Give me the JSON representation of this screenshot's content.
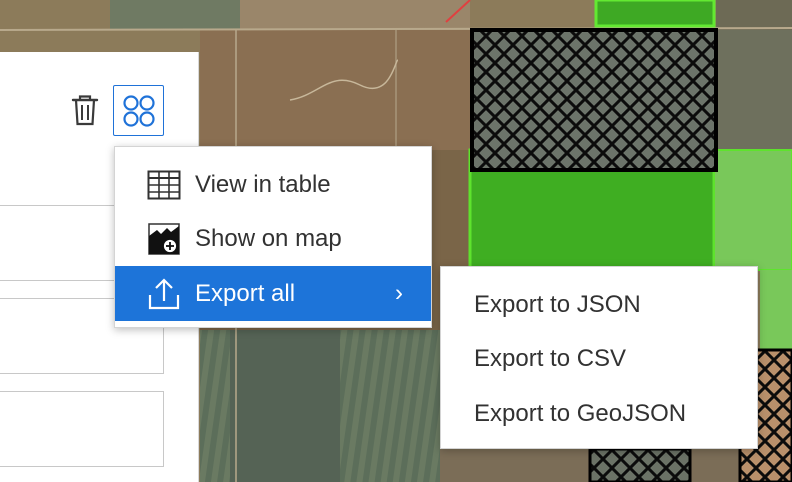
{
  "map": {
    "colors": {
      "field_brown": "#8a7a5c",
      "field_green": "#3fae22",
      "field_light_green": "#79c85a",
      "hatch": "#111111",
      "selection_outline": "#5ee32d"
    }
  },
  "panel": {
    "delete_icon": "trash-icon",
    "more_icon": "grid-dots-icon"
  },
  "menu": {
    "items": [
      {
        "label": "View in table",
        "icon": "table-icon"
      },
      {
        "label": "Show on map",
        "icon": "map-zoom-icon"
      },
      {
        "label": "Export all",
        "icon": "upload-icon",
        "chevron": "›",
        "active": true
      }
    ]
  },
  "submenu": {
    "items": [
      {
        "label": "Export to JSON"
      },
      {
        "label": "Export to CSV"
      },
      {
        "label": "Export to GeoJSON"
      }
    ]
  },
  "theme": {
    "accent": "#1d74d9",
    "text": "#323232"
  }
}
